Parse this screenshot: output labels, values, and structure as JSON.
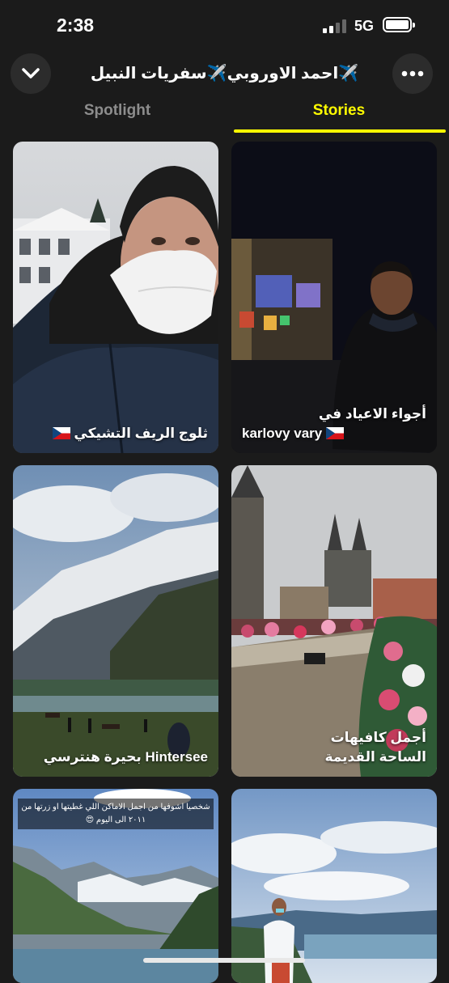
{
  "status_bar": {
    "time": "2:38",
    "network": "5G"
  },
  "header": {
    "title": "✈️احمد الاوروبي✈️سفريات النبيل"
  },
  "tabs": [
    {
      "label": "Spotlight",
      "active": false
    },
    {
      "label": "Stories",
      "active": true
    }
  ],
  "colors": {
    "background": "#1b1b1b",
    "accent": "#fffc00",
    "inactive_tab": "#8d8d8d"
  },
  "icons": {
    "back": "chevron-down-icon",
    "more": "ellipsis-icon",
    "flag": "czech-flag-icon"
  },
  "stories": [
    {
      "caption": "ثلوج الريف التشيكي",
      "flag": "czech"
    },
    {
      "caption_line1": "أجواء الاعياد في",
      "caption_line2": "karlovy vary",
      "flag": "czech"
    },
    {
      "caption_rtl": "بحيرة هنترسي",
      "caption_ltr": "Hintersee"
    },
    {
      "caption_line1": "أجمل كافيهات",
      "caption_line2": "الساحة القديمة"
    },
    {
      "overlay": "شخصيا اشوفها من اجمل الاماكن اللي غطيتها او زرتها من ٢٠١١ الى اليوم 😍"
    },
    {}
  ]
}
